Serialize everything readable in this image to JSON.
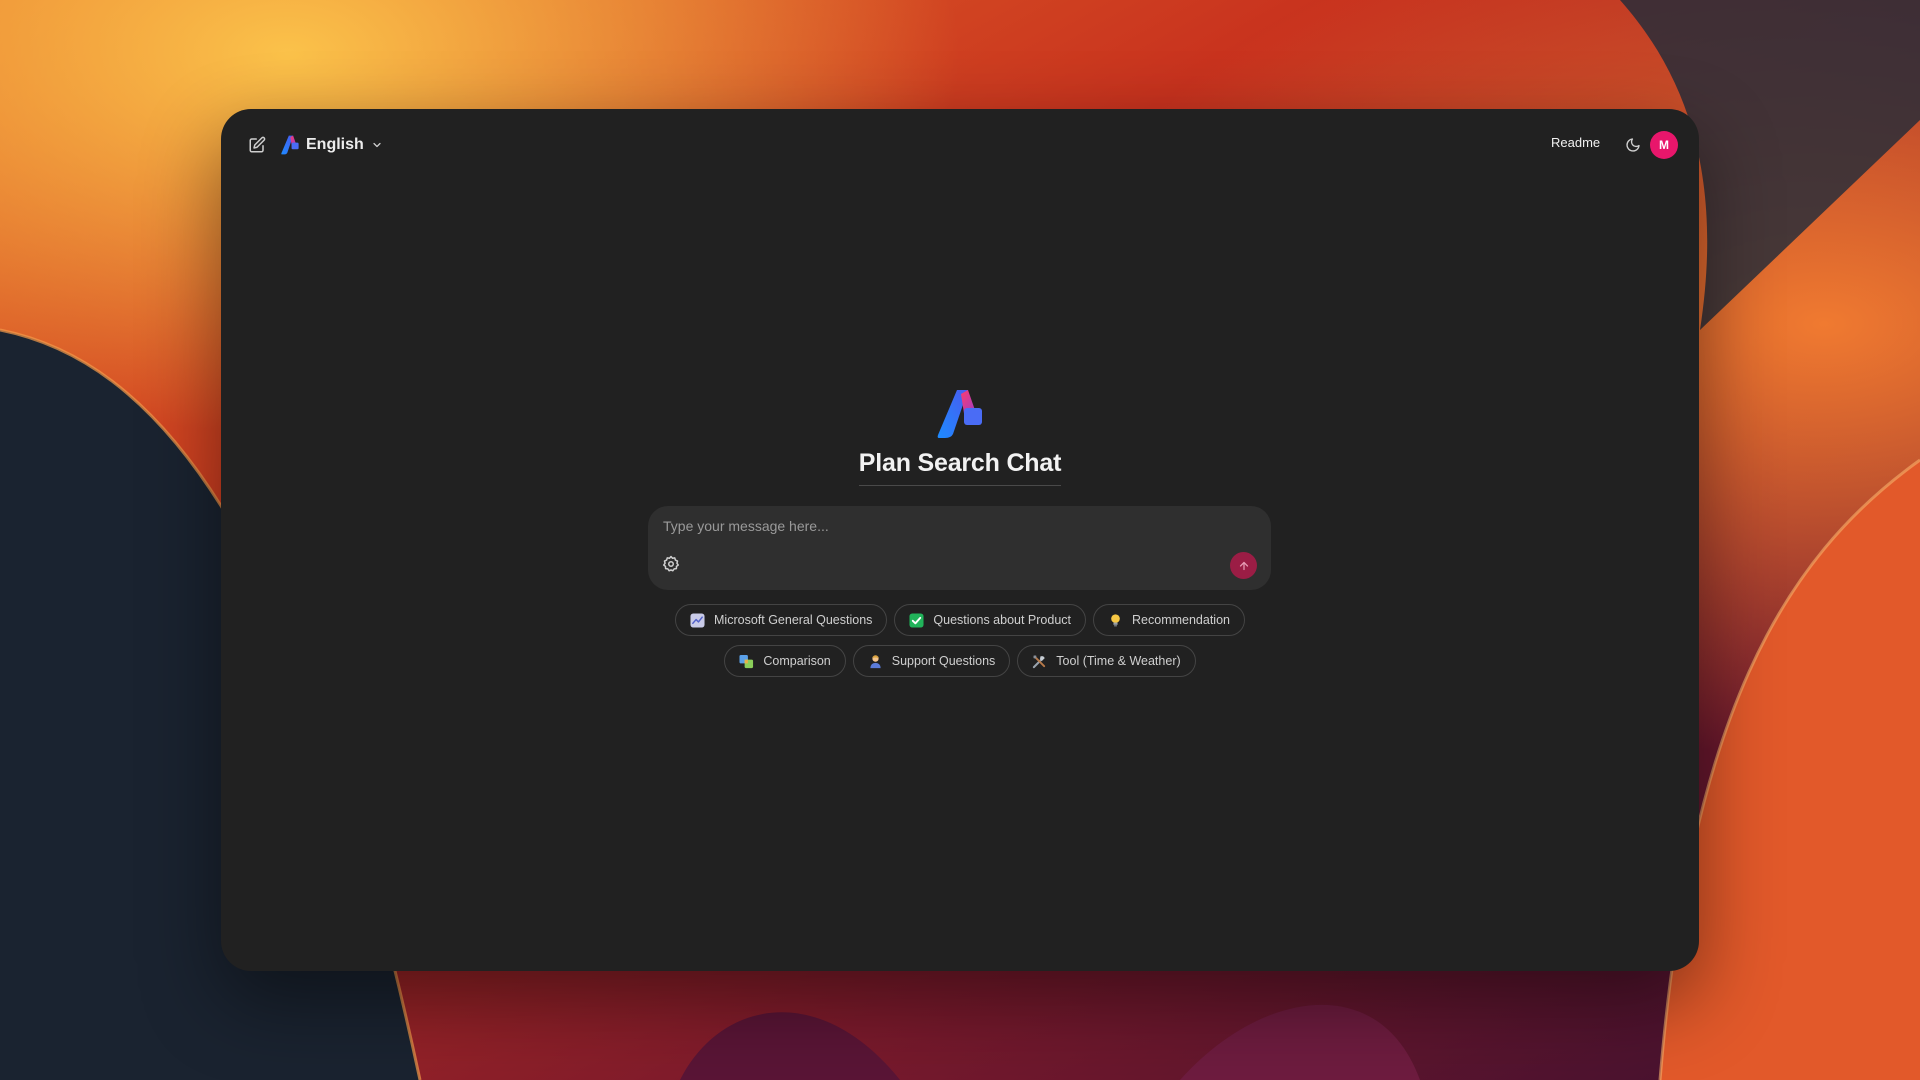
{
  "header": {
    "language_label": "English",
    "readme_label": "Readme",
    "avatar_initial": "M"
  },
  "main": {
    "title": "Plan Search Chat",
    "composer": {
      "placeholder": "Type your message here...",
      "value": ""
    },
    "suggestions_row1": [
      {
        "label": "Microsoft General Questions",
        "icon": "chart-icon"
      },
      {
        "label": "Questions about Product",
        "icon": "check-mark-icon"
      },
      {
        "label": "Recommendation",
        "icon": "light-bulb-icon"
      }
    ],
    "suggestions_row2": [
      {
        "label": "Comparison",
        "icon": "compare-icon"
      },
      {
        "label": "Support Questions",
        "icon": "support-person-icon"
      },
      {
        "label": "Tool (Time & Weather)",
        "icon": "tools-icon"
      }
    ]
  },
  "colors": {
    "window_bg": "#212121",
    "composer_bg": "#2f2f2f",
    "send_button": "#9b1d45",
    "avatar_bg": "#e8166b",
    "check_green": "#21b35a"
  }
}
